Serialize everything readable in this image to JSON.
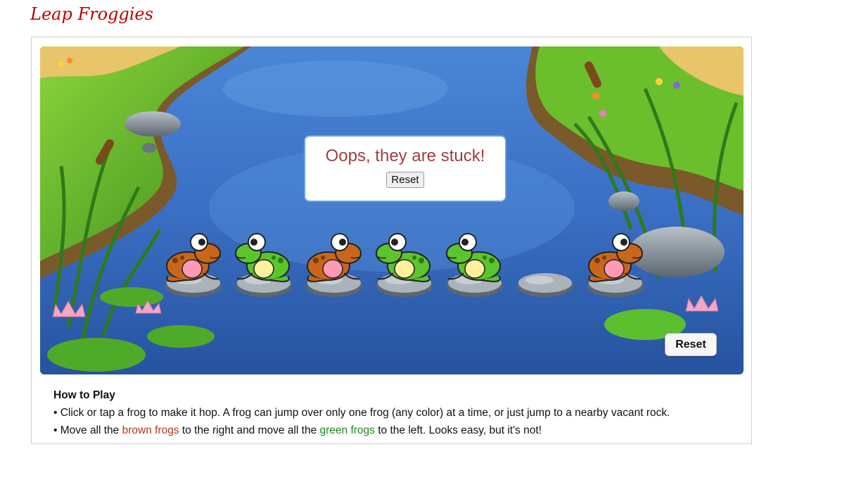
{
  "page": {
    "title": "Leap Froggies"
  },
  "game": {
    "rocks": [
      {
        "frog": "brown"
      },
      {
        "frog": "green"
      },
      {
        "frog": "brown"
      },
      {
        "frog": "green"
      },
      {
        "frog": "green"
      },
      {
        "frog": null
      },
      {
        "frog": "brown"
      }
    ],
    "colors": {
      "brown": "#c8661a",
      "green": "#5cc42c",
      "water": "#3f7ecf"
    }
  },
  "dialog": {
    "message": "Oops, they are stuck!",
    "reset_label": "Reset"
  },
  "controls": {
    "reset_label": "Reset"
  },
  "instructions": {
    "title": "How to Play",
    "line1": "• Click or tap a frog to make it hop.  A frog can jump over only one frog (any color) at a time, or just jump to a nearby vacant rock.",
    "line2_before": "• Move all the ",
    "line2_brown": "brown frogs",
    "line2_middle": " to the right  and  move all the ",
    "line2_green": "green frogs",
    "line2_after": " to the left.  Looks easy, but it's not!"
  }
}
